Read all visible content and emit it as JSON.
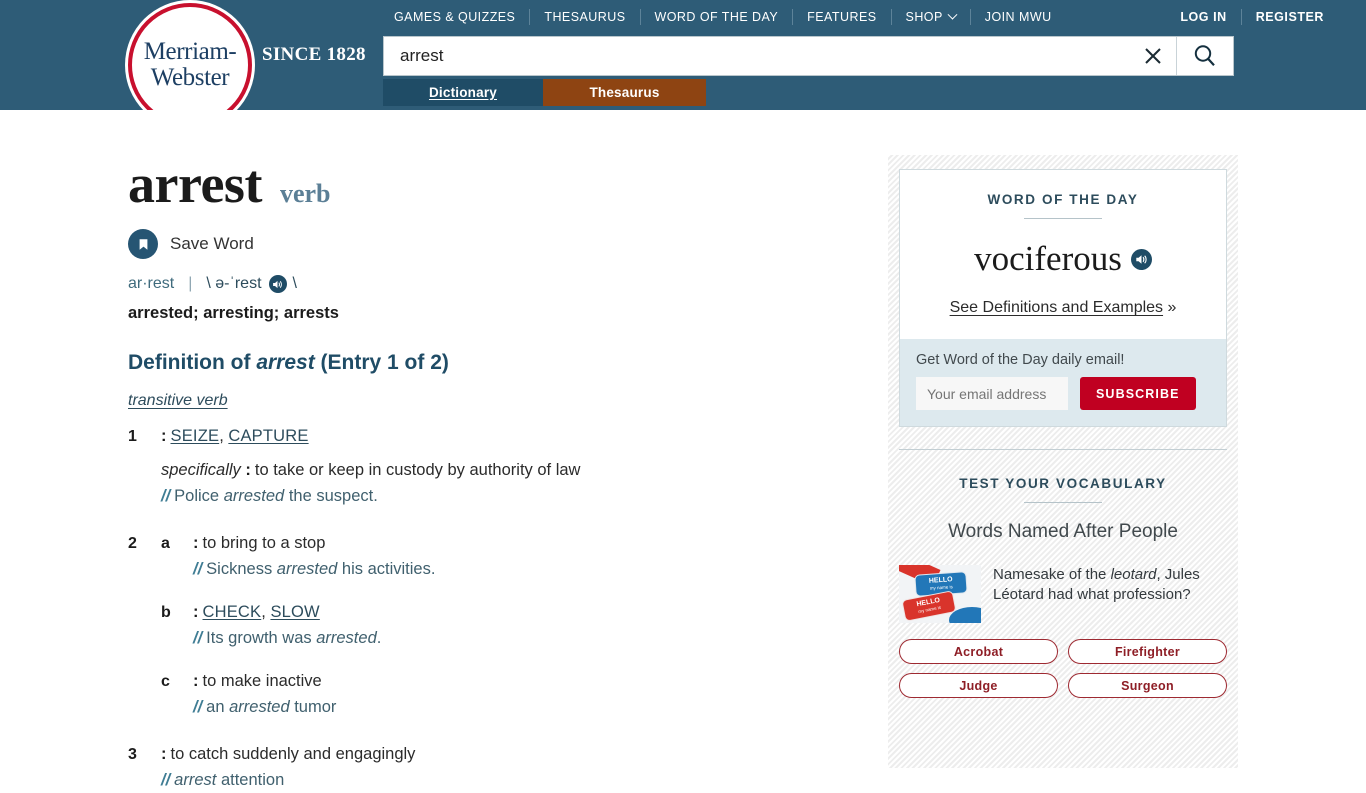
{
  "header": {
    "logo_line1": "Merriam-",
    "logo_line2": "Webster",
    "since": "SINCE 1828",
    "nav": [
      {
        "label": "GAMES & QUIZZES"
      },
      {
        "label": "THESAURUS"
      },
      {
        "label": "WORD OF THE DAY"
      },
      {
        "label": "FEATURES"
      },
      {
        "label": "SHOP",
        "has_chevron": true
      },
      {
        "label": "JOIN MWU"
      }
    ],
    "auth": [
      {
        "label": "LOG IN"
      },
      {
        "label": "REGISTER"
      }
    ],
    "bg_color": "#2e5c77"
  },
  "search": {
    "value": "arrest",
    "placeholder": "",
    "clear_icon": "close-x-icon",
    "search_icon": "magnifier-icon"
  },
  "tabs": [
    {
      "label": "Dictionary",
      "active": true,
      "color": "#1f4c66"
    },
    {
      "label": "Thesaurus",
      "active": false,
      "color": "#8e4412"
    }
  ],
  "entry": {
    "headword": "arrest",
    "part_of_speech": "verb",
    "save_word_label": "Save Word",
    "save_icon": "bookmark-icon",
    "syllabification": "ar·rest",
    "divider": "|",
    "pron_open": "\\ ə-ˈrest",
    "pron_close": "\\",
    "audio_icon": "speaker-icon",
    "inflections": "arrested; arresting; arrests",
    "definition_heading_prefix": "Definition of ",
    "definition_heading_word": "arrest",
    "definition_heading_suffix": " (Entry 1 of 2)",
    "verb_group_label": "transitive verb",
    "senses": [
      {
        "number": "1",
        "letter": "",
        "colon": ":",
        "text": "",
        "links": [
          "SEIZE",
          "CAPTURE"
        ],
        "sub": {
          "label": "specifically",
          "colon": ":",
          "text": "to take or keep in custody by authority of law"
        },
        "example": {
          "mark": "//",
          "pre": "Police ",
          "em": "arrested",
          "post": " the suspect."
        }
      },
      {
        "number": "2",
        "letter": "a",
        "colon": ":",
        "text": "to bring to a stop",
        "links": [],
        "example": {
          "mark": "//",
          "pre": "Sickness ",
          "em": "arrested",
          "post": " his activities."
        }
      },
      {
        "number": "",
        "letter": "b",
        "colon": ":",
        "text": "",
        "links": [
          "CHECK",
          "SLOW"
        ],
        "example": {
          "mark": "//",
          "pre": "Its growth was ",
          "em": "arrested",
          "post": "."
        }
      },
      {
        "number": "",
        "letter": "c",
        "colon": ":",
        "text": "to make inactive",
        "links": [],
        "example": {
          "mark": "//",
          "pre": "an ",
          "em": "arrested",
          "post": " tumor"
        }
      },
      {
        "number": "3",
        "letter": "",
        "colon": ":",
        "text": "to catch suddenly and engagingly",
        "links": [],
        "example": {
          "mark": "//",
          "pre": "",
          "em": "arrest",
          "post": " attention"
        }
      }
    ]
  },
  "sidebar": {
    "wotd": {
      "title": "WORD OF THE DAY",
      "word": "vociferous",
      "audio_icon": "speaker-icon",
      "link": "See Definitions and Examples",
      "link_suffix": " »",
      "signup_label": "Get Word of the Day daily email!",
      "email_placeholder": "Your email address",
      "subscribe_label": "SUBSCRIBE",
      "subscribe_color": "#c00021"
    },
    "quiz": {
      "title": "TEST YOUR VOCABULARY",
      "subtitle": "Words Named After People",
      "thumb_alt": "name-tag-image",
      "thumb_text": "HELLO",
      "thumb_subtext": "my name is",
      "question_pre": "Namesake of the ",
      "question_em": "leotard",
      "question_post": ", Jules Léotard had what profession?",
      "answers": [
        "Acrobat",
        "Firefighter",
        "Judge",
        "Surgeon"
      ],
      "answer_color": "#8e1e26"
    }
  }
}
